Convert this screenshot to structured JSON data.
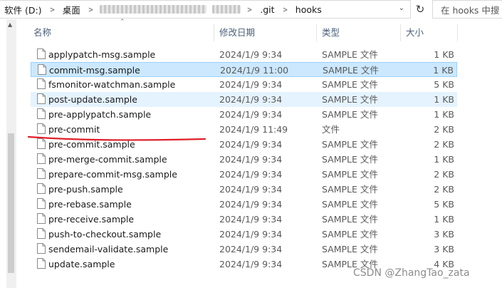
{
  "address_bar": {
    "crumbs": [
      "软件 (D:)",
      "桌面",
      ".git",
      "hooks"
    ]
  },
  "search": {
    "placeholder": "在 hooks 中搜"
  },
  "columns": {
    "name": "名称",
    "date": "修改日期",
    "type": "类型",
    "size": "大小"
  },
  "files": [
    {
      "name": "applypatch-msg.sample",
      "date": "2024/1/9 9:34",
      "type": "SAMPLE 文件",
      "size": "1 KB"
    },
    {
      "name": "commit-msg.sample",
      "date": "2024/1/9 11:00",
      "type": "SAMPLE 文件",
      "size": "1 KB"
    },
    {
      "name": "fsmonitor-watchman.sample",
      "date": "2024/1/9 9:34",
      "type": "SAMPLE 文件",
      "size": "5 KB"
    },
    {
      "name": "post-update.sample",
      "date": "2024/1/9 9:34",
      "type": "SAMPLE 文件",
      "size": "1 KB"
    },
    {
      "name": "pre-applypatch.sample",
      "date": "2024/1/9 9:34",
      "type": "SAMPLE 文件",
      "size": "1 KB"
    },
    {
      "name": "pre-commit",
      "date": "2024/1/9 11:49",
      "type": "文件",
      "size": "2 KB"
    },
    {
      "name": "pre-commit.sample",
      "date": "2024/1/9 9:34",
      "type": "SAMPLE 文件",
      "size": "2 KB"
    },
    {
      "name": "pre-merge-commit.sample",
      "date": "2024/1/9 9:34",
      "type": "SAMPLE 文件",
      "size": "1 KB"
    },
    {
      "name": "prepare-commit-msg.sample",
      "date": "2024/1/9 9:34",
      "type": "SAMPLE 文件",
      "size": "2 KB"
    },
    {
      "name": "pre-push.sample",
      "date": "2024/1/9 9:34",
      "type": "SAMPLE 文件",
      "size": "2 KB"
    },
    {
      "name": "pre-rebase.sample",
      "date": "2024/1/9 9:34",
      "type": "SAMPLE 文件",
      "size": "5 KB"
    },
    {
      "name": "pre-receive.sample",
      "date": "2024/1/9 9:34",
      "type": "SAMPLE 文件",
      "size": "1 KB"
    },
    {
      "name": "push-to-checkout.sample",
      "date": "2024/1/9 9:34",
      "type": "SAMPLE 文件",
      "size": "3 KB"
    },
    {
      "name": "sendemail-validate.sample",
      "date": "2024/1/9 9:34",
      "type": "SAMPLE 文件",
      "size": "3 KB"
    },
    {
      "name": "update.sample",
      "date": "2024/1/9 9:34",
      "type": "SAMPLE 文件",
      "size": "4 KB"
    }
  ],
  "selected_file": "commit-msg.sample",
  "hovered_file": "post-update.sample",
  "annotated_file": "pre-commit",
  "colors": {
    "selection": "#cce8ff",
    "selection_border": "#99d1ff",
    "hover": "#e5f3ff",
    "annotation": "#e0202a",
    "header_text": "#4c607a"
  },
  "watermark": "CSDN @ZhangTao_zata",
  "icons": {
    "file": "file-icon",
    "refresh": "refresh-icon",
    "dropdown": "chevron-down-icon",
    "breadcrumb_separator": "chevron-right-icon",
    "sort": "sort-up-icon"
  }
}
